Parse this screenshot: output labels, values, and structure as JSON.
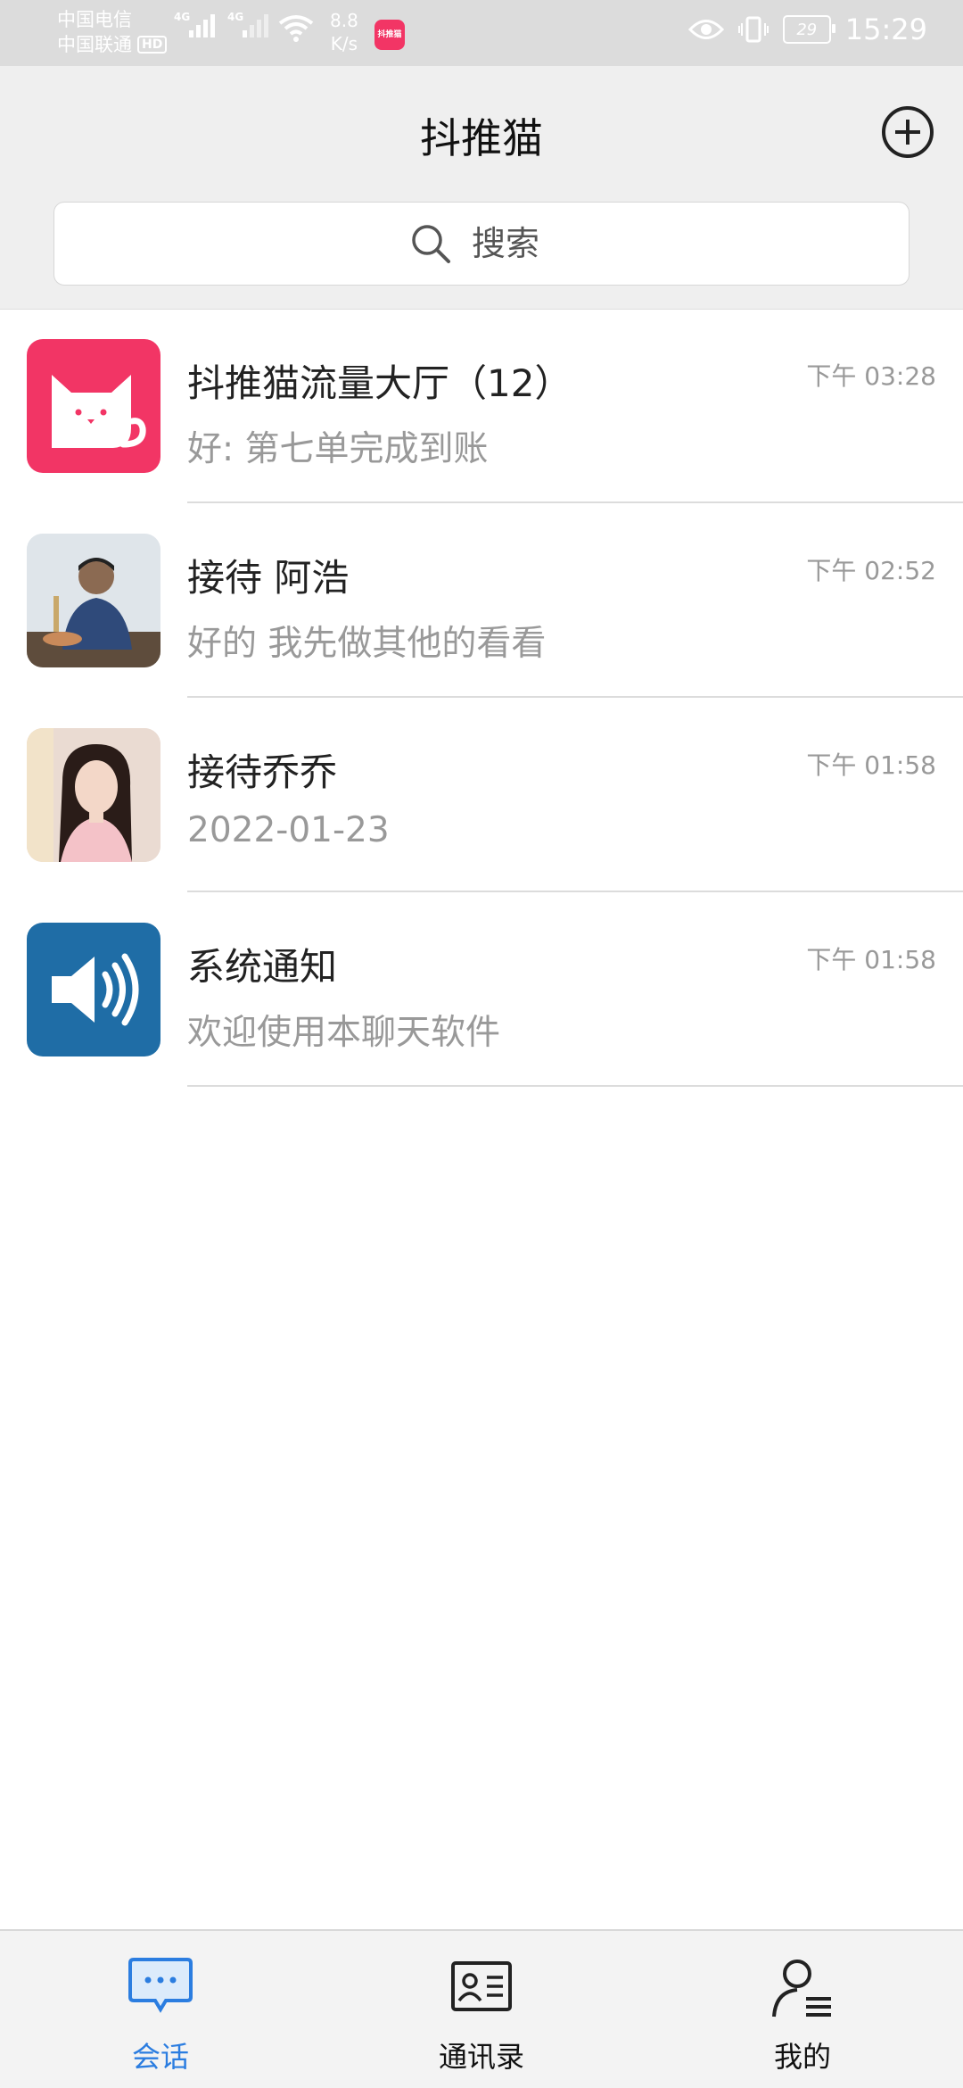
{
  "status_bar": {
    "carrier_1": "中国电信",
    "carrier_2": "中国联通",
    "hd_badge": "HD",
    "network_1": "4G",
    "network_2": "4G",
    "net_speed_value": "8.8",
    "net_speed_unit": "K/s",
    "mini_app_label": "抖推猫",
    "battery": "29",
    "time": "15:29"
  },
  "header": {
    "title": "抖推猫",
    "search_placeholder": "搜索"
  },
  "conversations": [
    {
      "name": "抖推猫流量大厅（12）",
      "time": "下午 03:28",
      "preview": "好: 第七单完成到账",
      "avatar": "cat-logo"
    },
    {
      "name": "接待 阿浩",
      "time": "下午 02:52",
      "preview": "好的  我先做其他的看看",
      "avatar": "photo"
    },
    {
      "name": "接待乔乔",
      "time": "下午 01:58",
      "preview": "2022-01-23",
      "avatar": "photo"
    },
    {
      "name": "系统通知",
      "time": "下午 01:58",
      "preview": "欢迎使用本聊天软件",
      "avatar": "speaker-icon"
    }
  ],
  "bottom_nav": {
    "tabs": [
      {
        "label": "会话",
        "icon": "chat-bubble-icon",
        "active": true
      },
      {
        "label": "通讯录",
        "icon": "contact-card-icon",
        "active": false
      },
      {
        "label": "我的",
        "icon": "profile-icon",
        "active": false
      }
    ]
  },
  "colors": {
    "accent": "#2b7de0",
    "brand_pink": "#f23565",
    "notification_blue": "#1f6da6"
  }
}
